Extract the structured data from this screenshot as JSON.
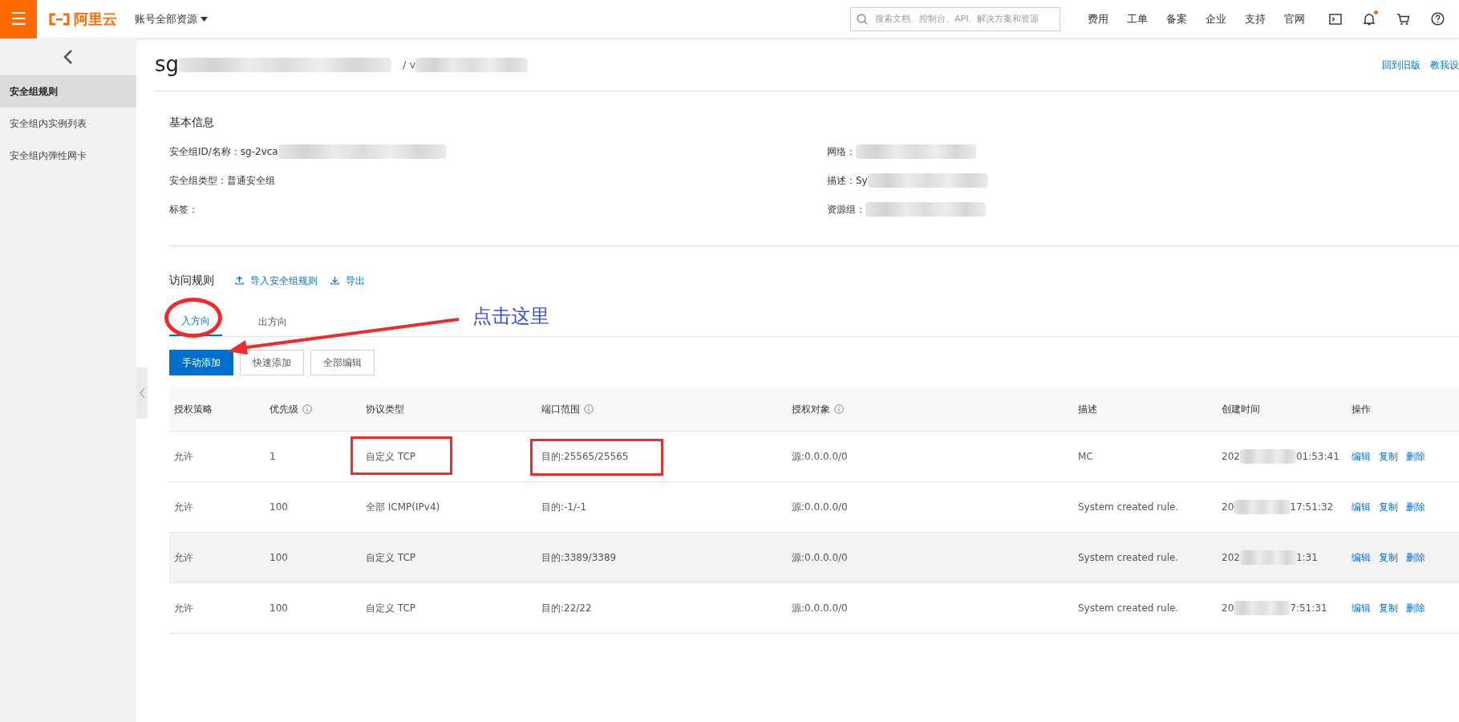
{
  "topbar": {
    "menu_glyph": "☰",
    "brand": "阿里云",
    "resource_switch": "账号全部资源",
    "resource_switch_expanded": false,
    "search_placeholder": "搜索文档、控制台、API、解决方案和资源",
    "nav": [
      "费用",
      "工单",
      "备案",
      "企业",
      "支持",
      "官网"
    ],
    "has_notification": true
  },
  "sidebar": {
    "items": [
      {
        "label": "安全组规则",
        "selected": true
      },
      {
        "label": "安全组内实例列表",
        "selected": false
      },
      {
        "label": "安全组内弹性网卡",
        "selected": false
      }
    ]
  },
  "header": {
    "title": "sg",
    "title_suffix": "/ v",
    "links": [
      "回到旧版",
      "教我设"
    ]
  },
  "basic_info": {
    "title": "基本信息",
    "left": [
      {
        "label": "安全组ID/名称：",
        "value": "sg-2vca",
        "blurred": true
      },
      {
        "label": "安全组类型：",
        "value": "普通安全组",
        "blurred": false
      },
      {
        "label": "标签：",
        "blurred": false
      }
    ],
    "right": [
      {
        "label": "网络：",
        "blurred": true
      },
      {
        "label": "描述：",
        "value": "Sy",
        "blurred": true
      },
      {
        "label": "资源组：",
        "blurred": true
      }
    ]
  },
  "rules": {
    "title": "访问规则",
    "actions": [
      "导入安全组规则",
      "导出"
    ],
    "tabs": [
      {
        "label": "入方向",
        "selected": true,
        "circled": true
      },
      {
        "label": "出方向",
        "selected": false,
        "circled": false
      }
    ],
    "buttons": [
      {
        "label": "手动添加",
        "kind": "primary"
      },
      {
        "label": "快速添加",
        "kind": "default"
      },
      {
        "label": "全部编辑",
        "kind": "default"
      }
    ],
    "columns": [
      {
        "label": "授权策略",
        "info": false
      },
      {
        "label": "优先级",
        "info": true
      },
      {
        "label": "协议类型",
        "info": false
      },
      {
        "label": "端口范围",
        "info": true
      },
      {
        "label": "授权对象",
        "info": true
      },
      {
        "label": "描述",
        "info": false
      },
      {
        "label": "创建时间",
        "info": false
      },
      {
        "label": "操作",
        "info": false
      }
    ],
    "rows": [
      {
        "policy": "允许",
        "priority": "1",
        "protocol": "自定义 TCP",
        "port": "目的:25565/25565",
        "source": "源:0.0.0.0/0",
        "description": "MC",
        "created_start": "202",
        "created_end": "01:53:41",
        "actions": [
          "编辑",
          "复制",
          "删除"
        ],
        "boxed": true,
        "shaded": false
      },
      {
        "policy": "允许",
        "priority": "100",
        "protocol": "全部 ICMP(IPv4)",
        "port": "目的:-1/-1",
        "source": "源:0.0.0.0/0",
        "description": "System created rule.",
        "created_start": "20",
        "created_end": "17:51:32",
        "actions": [
          "编辑",
          "复制",
          "删除"
        ],
        "boxed": false,
        "shaded": false
      },
      {
        "policy": "允许",
        "priority": "100",
        "protocol": "自定义 TCP",
        "port": "目的:3389/3389",
        "source": "源:0.0.0.0/0",
        "description": "System created rule.",
        "created_start": "202",
        "created_end": "1:31",
        "actions": [
          "编辑",
          "复制",
          "删除"
        ],
        "boxed": false,
        "shaded": true
      },
      {
        "policy": "允许",
        "priority": "100",
        "protocol": "自定义 TCP",
        "port": "目的:22/22",
        "source": "源:0.0.0.0/0",
        "description": "System created rule.",
        "created_start": "20",
        "created_end": "7:51:31",
        "actions": [
          "编辑",
          "复制",
          "删除"
        ],
        "boxed": false,
        "shaded": false
      }
    ]
  },
  "annotation": {
    "note": "点击这里"
  }
}
